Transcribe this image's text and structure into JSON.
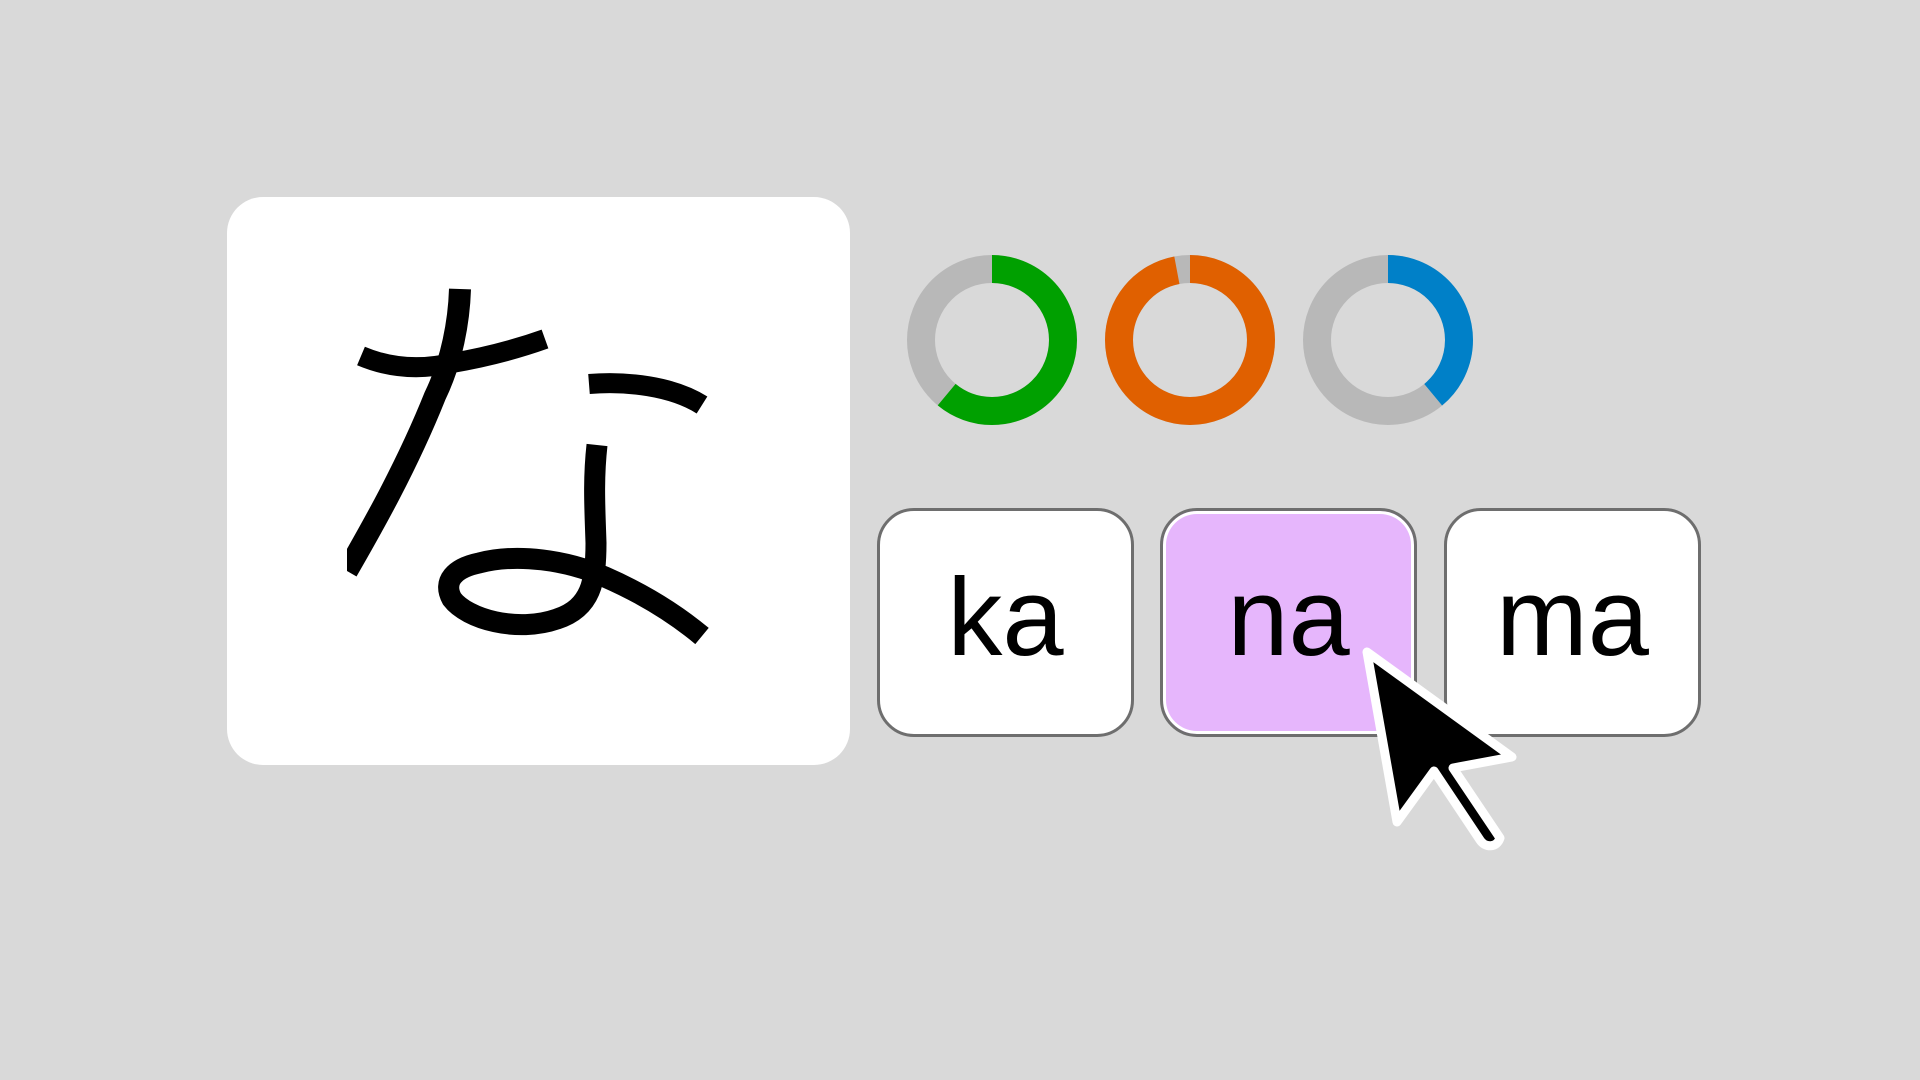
{
  "quiz": {
    "prompt_character": "な",
    "options": [
      {
        "label": "ka",
        "selected": false
      },
      {
        "label": "na",
        "selected": true
      },
      {
        "label": "ma",
        "selected": false
      }
    ]
  },
  "stats_rings": [
    {
      "name": "green-ring",
      "color": "#00a000",
      "fraction": 0.61
    },
    {
      "name": "orange-ring",
      "color": "#e06000",
      "fraction": 0.97
    },
    {
      "name": "blue-ring",
      "color": "#0080c8",
      "fraction": 0.39
    }
  ],
  "colors": {
    "background": "#d9d9d9",
    "card": "#ffffff",
    "ring_track": "#b8b8b8",
    "selected_option": "#e6b6fc",
    "option_border": "#6e6e6e"
  },
  "icons": {
    "cursor": "mouse-pointer-icon"
  }
}
